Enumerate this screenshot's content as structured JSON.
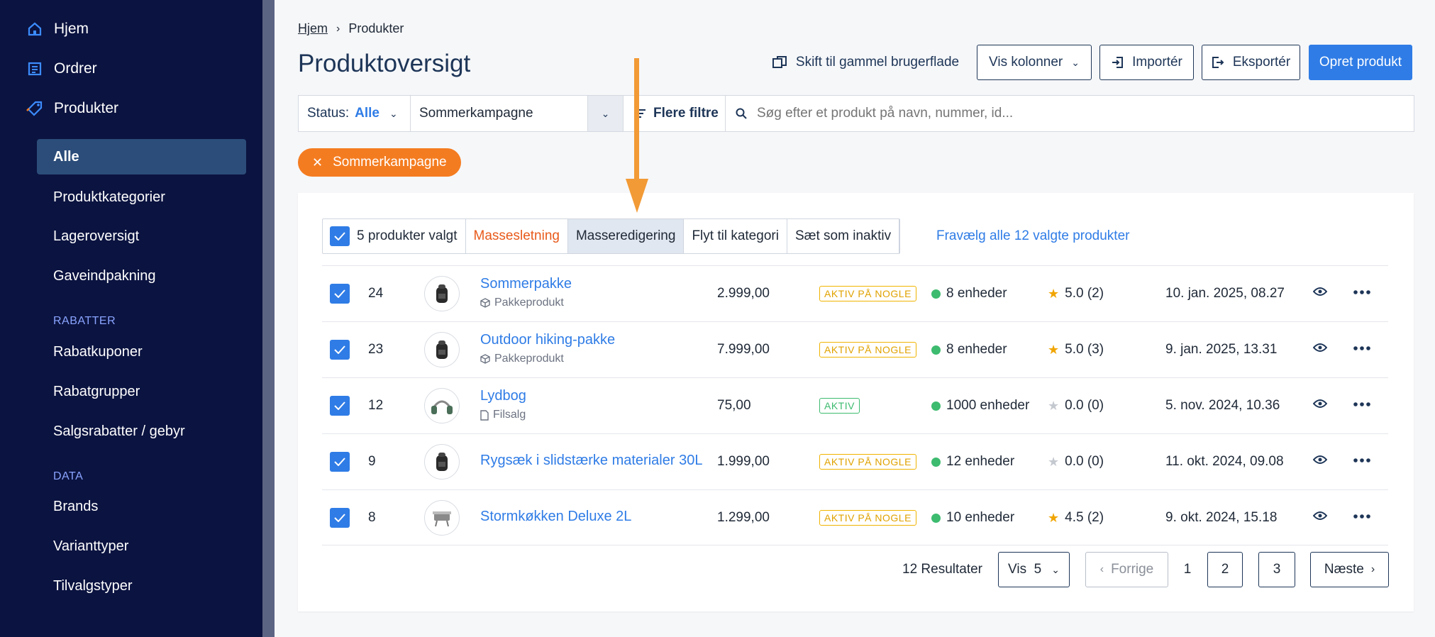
{
  "sidebar": {
    "home": "Hjem",
    "orders": "Ordrer",
    "products": "Produkter",
    "product_sub": [
      "Alle",
      "Produktkategorier",
      "Lageroversigt",
      "Gaveindpakning"
    ],
    "section_discounts": "RABATTER",
    "discount_items": [
      "Rabatkuponer",
      "Rabatgrupper",
      "Salgsrabatter / gebyr"
    ],
    "section_data": "DATA",
    "data_items": [
      "Brands",
      "Varianttyper",
      "Tilvalgstyper"
    ]
  },
  "breadcrumb": {
    "home": "Hjem",
    "current": "Produkter"
  },
  "page_title": "Produktoversigt",
  "toolbar": {
    "old_ui": "Skift til gammel brugerflade",
    "columns": "Vis kolonner",
    "import": "Importér",
    "export": "Eksportér",
    "create": "Opret produkt"
  },
  "filters": {
    "status_label": "Status:",
    "status_value": "Alle",
    "campaign": "Sommerkampagne",
    "more": "Flere filtre",
    "search_placeholder": "Søg efter et produkt på navn, nummer, id..."
  },
  "active_chip": "Sommerkampagne",
  "bulk": {
    "selected": "5 produkter valgt",
    "delete": "Massesletning",
    "edit": "Masseredigering",
    "move": "Flyt til kategori",
    "inactive": "Sæt som inaktiv",
    "deselect": "Fravælg alle 12 valgte produkter"
  },
  "rows": [
    {
      "id": "24",
      "name": "Sommerpakke",
      "type": "Pakkeprodukt",
      "price": "2.999,00",
      "status": "AKTIV PÅ NOGLE",
      "stock": "8 enheder",
      "rating": "5.0 (2)",
      "date": "10. jan. 2025, 08.27"
    },
    {
      "id": "23",
      "name": "Outdoor hiking-pakke",
      "type": "Pakkeprodukt",
      "price": "7.999,00",
      "status": "AKTIV PÅ NOGLE",
      "stock": "8 enheder",
      "rating": "5.0 (3)",
      "date": "9. jan. 2025, 13.31"
    },
    {
      "id": "12",
      "name": "Lydbog",
      "type": "Filsalg",
      "price": "75,00",
      "status": "AKTIV",
      "stock": "1000 enheder",
      "rating": "0.0 (0)",
      "date": "5. nov. 2024, 10.36"
    },
    {
      "id": "9",
      "name": "Rygsæk i slidstærke materialer 30L",
      "type": "",
      "price": "1.999,00",
      "status": "AKTIV PÅ NOGLE",
      "stock": "12 enheder",
      "rating": "0.0 (0)",
      "date": "11. okt. 2024, 09.08"
    },
    {
      "id": "8",
      "name": "Stormkøkken Deluxe 2L",
      "type": "",
      "price": "1.299,00",
      "status": "AKTIV PÅ NOGLE",
      "stock": "10 enheder",
      "rating": "4.5 (2)",
      "date": "9. okt. 2024, 15.18"
    }
  ],
  "pagination": {
    "results": "12 Resultater",
    "per_page": "Vis  5",
    "prev": "Forrige",
    "pages": [
      "1",
      "2",
      "3"
    ],
    "next": "Næste"
  },
  "colors": {
    "accent": "#2f7ce6",
    "sidebar": "#0b1340",
    "chip": "#f47c20",
    "danger": "#e85a1b",
    "warning": "#f0a500",
    "success": "#3dbb6f",
    "arrow": "#f29a36"
  }
}
